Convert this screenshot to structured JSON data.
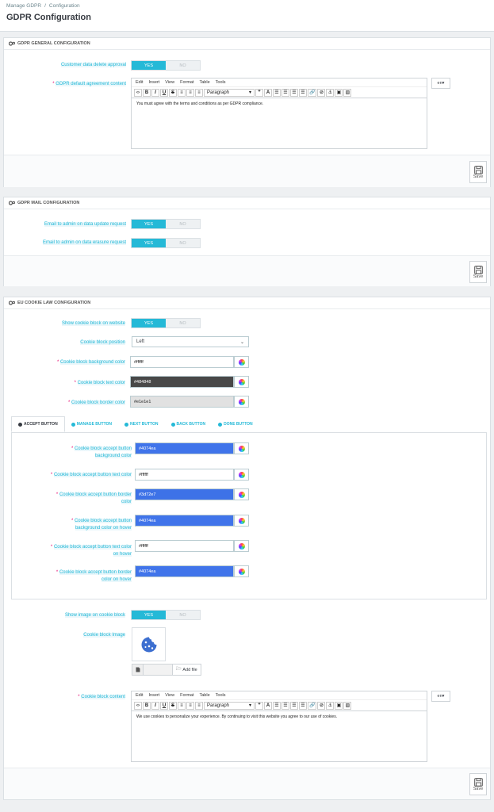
{
  "breadcrumb": {
    "root": "Manage GDPR",
    "sep": "/",
    "current": "Configuration"
  },
  "page_title": "GDPR Configuration",
  "general": {
    "heading": "GDPR GENERAL CONFIGURATION",
    "delete_approval_label": "Customer data delete approval",
    "agreement_label": "GDPR default agreement content",
    "agreement_text": "You must agree with the terms and conditions as per GDPR compliance.",
    "lang": "en"
  },
  "editor": {
    "menus": [
      "Edit",
      "Insert",
      "View",
      "Format",
      "Table",
      "Tools"
    ],
    "paragraph": "Paragraph"
  },
  "switch": {
    "yes": "YES",
    "no": "NO"
  },
  "save_label": "Save",
  "mail": {
    "heading": "GDPR MAIL CONFIGURATION",
    "update_label": "Email to admin on data update request",
    "erasure_label": "Email to admin on data erasure request"
  },
  "cookie": {
    "heading": "EU COOKIE LAW CONFIGURATION",
    "show_label": "Show cookie block on website",
    "position_label": "Cookie block position",
    "position_value": "Left",
    "bg_label": "Cookie block background color",
    "bg_value": "#ffffff",
    "text_label": "Cookie block text color",
    "text_value": "#484848",
    "border_label": "Cookie block border color",
    "border_value": "#e1e1e1",
    "tabs": [
      "ACCEPT BUTTON",
      "MANAGE BUTTON",
      "NEXT BUTTON",
      "BACK BUTTON",
      "DONE BUTTON"
    ],
    "accept": {
      "bg_label_1": "Cookie block accept button",
      "bg_label_2": "background color",
      "bg_value": "#4074ea",
      "text_label": "Cookie block accept button text color",
      "text_value": "#ffffff",
      "border_label_1": "Cookie block accept button border",
      "border_label_2": "color",
      "border_value": "#3d72e7",
      "bghover_label_1": "Cookie block accept button",
      "bghover_label_2": "background color on hover",
      "bghover_value": "#4074ea",
      "texthover_label_1": "Cookie block accept button text color",
      "texthover_label_2": "on hover",
      "texthover_value": "#ffffff",
      "borderhover_label_1": "Cookie block accept button border",
      "borderhover_label_2": "color on hover",
      "borderhover_value": "#4074ea"
    },
    "show_image_label": "Show image on cookie block",
    "image_label": "Cookie block Image",
    "add_file": "Add file",
    "content_label": "Cookie block content",
    "content_text": "We use cookies to personalize your experience. By continuing to visit this website you agree to our use of cookies.",
    "lang": "en"
  },
  "colors": {
    "accent": "#25b9d7",
    "required": "#e50b70",
    "blue": "#4074ea",
    "dark": "#484848"
  }
}
